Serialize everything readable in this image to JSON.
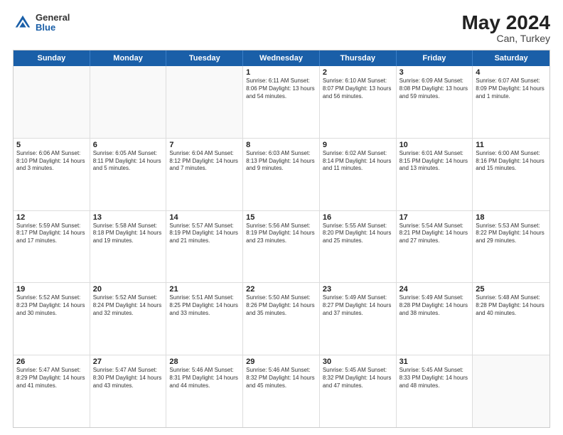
{
  "header": {
    "logo_general": "General",
    "logo_blue": "Blue",
    "month_year": "May 2024",
    "location": "Can, Turkey"
  },
  "days_of_week": [
    "Sunday",
    "Monday",
    "Tuesday",
    "Wednesday",
    "Thursday",
    "Friday",
    "Saturday"
  ],
  "weeks": [
    [
      {
        "day": "",
        "info": ""
      },
      {
        "day": "",
        "info": ""
      },
      {
        "day": "",
        "info": ""
      },
      {
        "day": "1",
        "info": "Sunrise: 6:11 AM\nSunset: 8:06 PM\nDaylight: 13 hours\nand 54 minutes."
      },
      {
        "day": "2",
        "info": "Sunrise: 6:10 AM\nSunset: 8:07 PM\nDaylight: 13 hours\nand 56 minutes."
      },
      {
        "day": "3",
        "info": "Sunrise: 6:09 AM\nSunset: 8:08 PM\nDaylight: 13 hours\nand 59 minutes."
      },
      {
        "day": "4",
        "info": "Sunrise: 6:07 AM\nSunset: 8:09 PM\nDaylight: 14 hours\nand 1 minute."
      }
    ],
    [
      {
        "day": "5",
        "info": "Sunrise: 6:06 AM\nSunset: 8:10 PM\nDaylight: 14 hours\nand 3 minutes."
      },
      {
        "day": "6",
        "info": "Sunrise: 6:05 AM\nSunset: 8:11 PM\nDaylight: 14 hours\nand 5 minutes."
      },
      {
        "day": "7",
        "info": "Sunrise: 6:04 AM\nSunset: 8:12 PM\nDaylight: 14 hours\nand 7 minutes."
      },
      {
        "day": "8",
        "info": "Sunrise: 6:03 AM\nSunset: 8:13 PM\nDaylight: 14 hours\nand 9 minutes."
      },
      {
        "day": "9",
        "info": "Sunrise: 6:02 AM\nSunset: 8:14 PM\nDaylight: 14 hours\nand 11 minutes."
      },
      {
        "day": "10",
        "info": "Sunrise: 6:01 AM\nSunset: 8:15 PM\nDaylight: 14 hours\nand 13 minutes."
      },
      {
        "day": "11",
        "info": "Sunrise: 6:00 AM\nSunset: 8:16 PM\nDaylight: 14 hours\nand 15 minutes."
      }
    ],
    [
      {
        "day": "12",
        "info": "Sunrise: 5:59 AM\nSunset: 8:17 PM\nDaylight: 14 hours\nand 17 minutes."
      },
      {
        "day": "13",
        "info": "Sunrise: 5:58 AM\nSunset: 8:18 PM\nDaylight: 14 hours\nand 19 minutes."
      },
      {
        "day": "14",
        "info": "Sunrise: 5:57 AM\nSunset: 8:19 PM\nDaylight: 14 hours\nand 21 minutes."
      },
      {
        "day": "15",
        "info": "Sunrise: 5:56 AM\nSunset: 8:19 PM\nDaylight: 14 hours\nand 23 minutes."
      },
      {
        "day": "16",
        "info": "Sunrise: 5:55 AM\nSunset: 8:20 PM\nDaylight: 14 hours\nand 25 minutes."
      },
      {
        "day": "17",
        "info": "Sunrise: 5:54 AM\nSunset: 8:21 PM\nDaylight: 14 hours\nand 27 minutes."
      },
      {
        "day": "18",
        "info": "Sunrise: 5:53 AM\nSunset: 8:22 PM\nDaylight: 14 hours\nand 29 minutes."
      }
    ],
    [
      {
        "day": "19",
        "info": "Sunrise: 5:52 AM\nSunset: 8:23 PM\nDaylight: 14 hours\nand 30 minutes."
      },
      {
        "day": "20",
        "info": "Sunrise: 5:52 AM\nSunset: 8:24 PM\nDaylight: 14 hours\nand 32 minutes."
      },
      {
        "day": "21",
        "info": "Sunrise: 5:51 AM\nSunset: 8:25 PM\nDaylight: 14 hours\nand 33 minutes."
      },
      {
        "day": "22",
        "info": "Sunrise: 5:50 AM\nSunset: 8:26 PM\nDaylight: 14 hours\nand 35 minutes."
      },
      {
        "day": "23",
        "info": "Sunrise: 5:49 AM\nSunset: 8:27 PM\nDaylight: 14 hours\nand 37 minutes."
      },
      {
        "day": "24",
        "info": "Sunrise: 5:49 AM\nSunset: 8:28 PM\nDaylight: 14 hours\nand 38 minutes."
      },
      {
        "day": "25",
        "info": "Sunrise: 5:48 AM\nSunset: 8:28 PM\nDaylight: 14 hours\nand 40 minutes."
      }
    ],
    [
      {
        "day": "26",
        "info": "Sunrise: 5:47 AM\nSunset: 8:29 PM\nDaylight: 14 hours\nand 41 minutes."
      },
      {
        "day": "27",
        "info": "Sunrise: 5:47 AM\nSunset: 8:30 PM\nDaylight: 14 hours\nand 43 minutes."
      },
      {
        "day": "28",
        "info": "Sunrise: 5:46 AM\nSunset: 8:31 PM\nDaylight: 14 hours\nand 44 minutes."
      },
      {
        "day": "29",
        "info": "Sunrise: 5:46 AM\nSunset: 8:32 PM\nDaylight: 14 hours\nand 45 minutes."
      },
      {
        "day": "30",
        "info": "Sunrise: 5:45 AM\nSunset: 8:32 PM\nDaylight: 14 hours\nand 47 minutes."
      },
      {
        "day": "31",
        "info": "Sunrise: 5:45 AM\nSunset: 8:33 PM\nDaylight: 14 hours\nand 48 minutes."
      },
      {
        "day": "",
        "info": ""
      }
    ]
  ]
}
